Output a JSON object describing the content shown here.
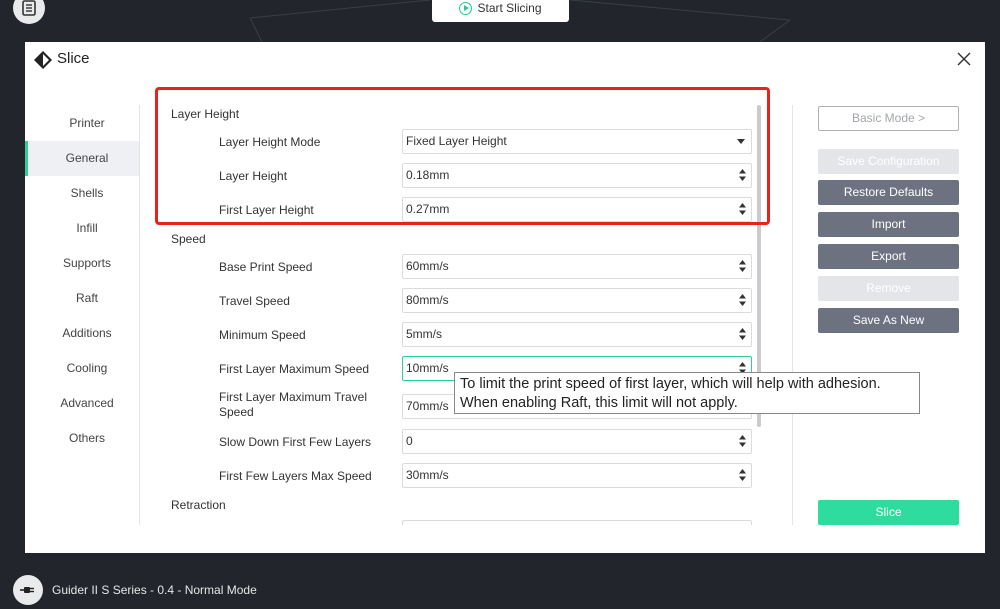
{
  "topbar": {
    "start_slicing_label": "Start Slicing"
  },
  "dialog": {
    "title": "Slice"
  },
  "nav": {
    "items": [
      {
        "label": "Printer",
        "active": false
      },
      {
        "label": "General",
        "active": true
      },
      {
        "label": "Shells",
        "active": false
      },
      {
        "label": "Infill",
        "active": false
      },
      {
        "label": "Supports",
        "active": false
      },
      {
        "label": "Raft",
        "active": false
      },
      {
        "label": "Additions",
        "active": false
      },
      {
        "label": "Cooling",
        "active": false
      },
      {
        "label": "Advanced",
        "active": false
      },
      {
        "label": "Others",
        "active": false
      }
    ]
  },
  "settings": {
    "layer_height_section": "Layer Height",
    "layer_height_mode_label": "Layer Height Mode",
    "layer_height_mode_value": "Fixed Layer Height",
    "layer_height_label": "Layer Height",
    "layer_height_value": "0.18mm",
    "first_layer_height_label": "First Layer Height",
    "first_layer_height_value": "0.27mm",
    "speed_section": "Speed",
    "base_print_speed_label": "Base Print Speed",
    "base_print_speed_value": "60mm/s",
    "travel_speed_label": "Travel Speed",
    "travel_speed_value": "80mm/s",
    "minimum_speed_label": "Minimum Speed",
    "minimum_speed_value": "5mm/s",
    "first_layer_max_speed_label": "First Layer Maximum Speed",
    "first_layer_max_speed_value": "10mm/s",
    "first_layer_max_travel_speed_label": "First Layer Maximum Travel Speed",
    "first_layer_max_travel_speed_value": "70mm/s",
    "slow_down_first_layers_label": "Slow Down First Few Layers",
    "slow_down_first_layers_value": "0",
    "first_few_layers_max_speed_label": "First Few Layers Max Speed",
    "first_few_layers_max_speed_value": "30mm/s",
    "retraction_section": "Retraction"
  },
  "tooltip": {
    "line1": "To limit the print speed of first layer, which will help with adhesion.",
    "line2": "When enabling Raft, this limit will not apply."
  },
  "actions": {
    "basic_mode_label": "Basic Mode >",
    "save_configuration_label": "Save Configuration",
    "restore_defaults_label": "Restore Defaults",
    "import_label": "Import",
    "export_label": "Export",
    "remove_label": "Remove",
    "save_as_new_label": "Save As New",
    "slice_label": "Slice"
  },
  "status": {
    "text": "Guider II S Series - 0.4 - Normal Mode"
  },
  "colors": {
    "accent_green": "#2fdc9f",
    "highlight_red": "#e8231b",
    "button_gray": "#6d7280"
  }
}
